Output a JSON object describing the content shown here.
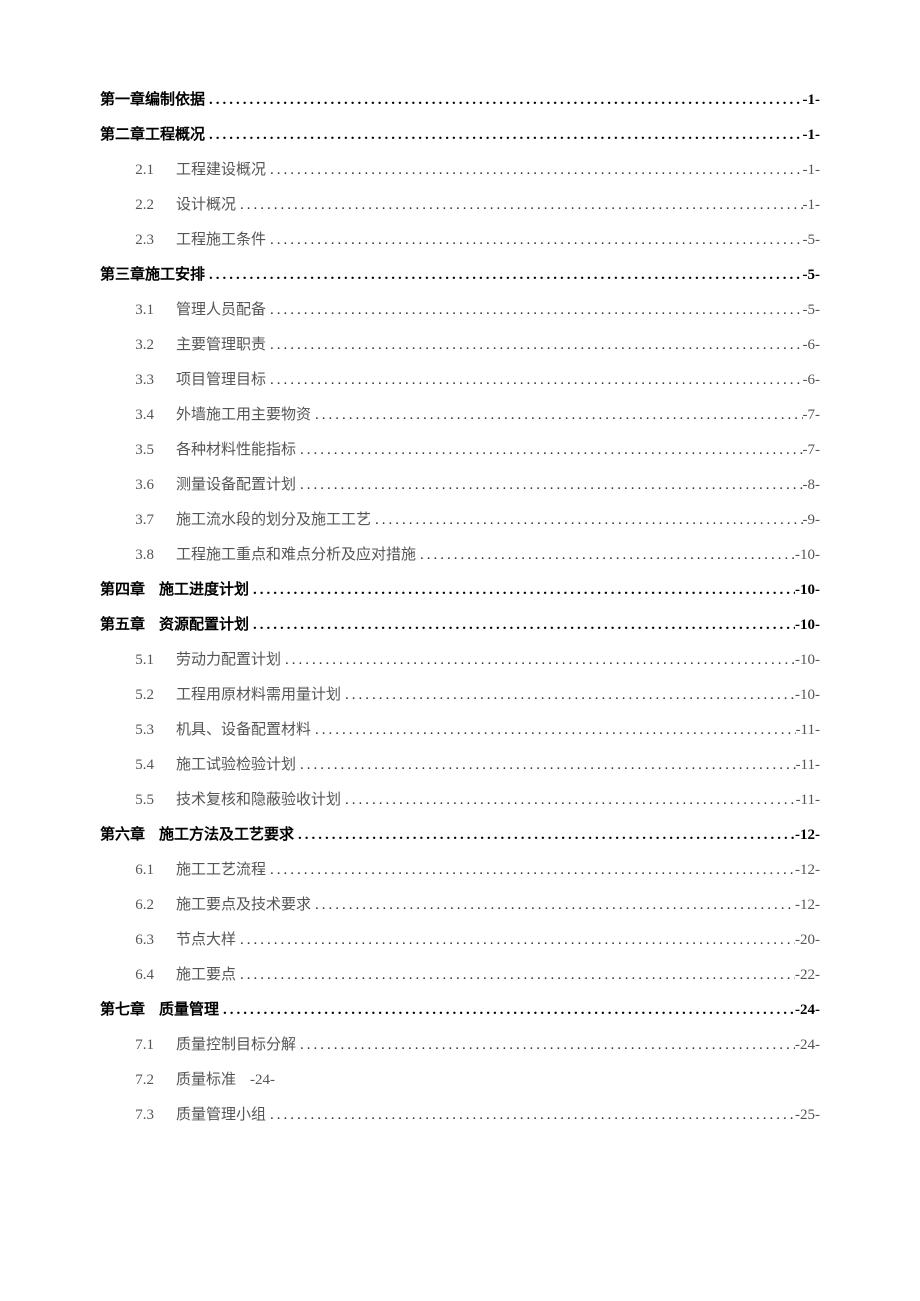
{
  "toc": [
    {
      "level": "chapter",
      "num": "第一章",
      "title": "编制依据",
      "page": "-1-",
      "inline": false
    },
    {
      "level": "chapter",
      "num": "第二章",
      "title": "工程概况",
      "page": "-1-",
      "inline": false
    },
    {
      "level": "section",
      "num": "2.1",
      "title": "工程建设概况",
      "page": "-1-",
      "inline": false
    },
    {
      "level": "section",
      "num": "2.2",
      "title": "设计概况",
      "page": "-1-",
      "inline": false
    },
    {
      "level": "section",
      "num": "2.3",
      "title": "工程施工条件",
      "page": "-5-",
      "inline": false
    },
    {
      "level": "chapter",
      "num": "第三章",
      "title": "施工安排",
      "page": "-5-",
      "inline": false
    },
    {
      "level": "section",
      "num": "3.1",
      "title": "管理人员配备",
      "page": "-5-",
      "inline": false
    },
    {
      "level": "section",
      "num": "3.2",
      "title": "主要管理职责",
      "page": "-6-",
      "inline": false
    },
    {
      "level": "section",
      "num": "3.3",
      "title": "项目管理目标",
      "page": "-6-",
      "inline": false
    },
    {
      "level": "section",
      "num": "3.4",
      "title": "外墙施工用主要物资",
      "page": "-7-",
      "inline": false
    },
    {
      "level": "section",
      "num": "3.5",
      "title": "各种材料性能指标",
      "page": "-7-",
      "inline": false
    },
    {
      "level": "section",
      "num": "3.6",
      "title": "测量设备配置计划",
      "page": "-8-",
      "inline": false
    },
    {
      "level": "section",
      "num": "3.7",
      "title": "施工流水段的划分及施工工艺",
      "page": "-9-",
      "inline": false
    },
    {
      "level": "section",
      "num": "3.8",
      "title": "工程施工重点和难点分析及应对措施",
      "page": "-10-",
      "inline": false
    },
    {
      "level": "chapter",
      "num": "第四章",
      "title": "施工进度计划",
      "page": "-10-",
      "inline": false
    },
    {
      "level": "chapter",
      "num": "第五章",
      "title": "资源配置计划",
      "page": "-10-",
      "inline": false
    },
    {
      "level": "section",
      "num": "5.1",
      "title": "劳动力配置计划",
      "page": "-10-",
      "inline": false
    },
    {
      "level": "section",
      "num": "5.2",
      "title": "工程用原材料需用量计划",
      "page": "-10-",
      "inline": false
    },
    {
      "level": "section",
      "num": "5.3",
      "title": "机具、设备配置材料",
      "page": "-11-",
      "inline": false
    },
    {
      "level": "section",
      "num": "5.4",
      "title": "施工试验检验计划",
      "page": "-11-",
      "inline": false
    },
    {
      "level": "section",
      "num": "5.5",
      "title": "技术复核和隐蔽验收计划",
      "page": "-11-",
      "inline": false
    },
    {
      "level": "chapter",
      "num": "第六章",
      "title": "施工方法及工艺要求",
      "page": "-12-",
      "inline": false
    },
    {
      "level": "section",
      "num": "6.1",
      "title": "施工工艺流程",
      "page": "-12-",
      "inline": false
    },
    {
      "level": "section",
      "num": "6.2",
      "title": "施工要点及技术要求",
      "page": "-12-",
      "inline": false
    },
    {
      "level": "section",
      "num": "6.3",
      "title": "节点大样",
      "page": "-20-",
      "inline": false
    },
    {
      "level": "section",
      "num": "6.4",
      "title": "施工要点",
      "page": "-22-",
      "inline": false
    },
    {
      "level": "chapter",
      "num": "第七章",
      "title": "质量管理",
      "page": "-24-",
      "inline": false
    },
    {
      "level": "section",
      "num": "7.1",
      "title": "质量控制目标分解",
      "page": "-24-",
      "inline": false
    },
    {
      "level": "section",
      "num": "7.2",
      "title": "质量标准",
      "page": "-24-",
      "inline": true
    },
    {
      "level": "section",
      "num": "7.3",
      "title": "质量管理小组",
      "page": "-25-",
      "inline": false
    }
  ],
  "dots": "........................................................................................................................................................"
}
